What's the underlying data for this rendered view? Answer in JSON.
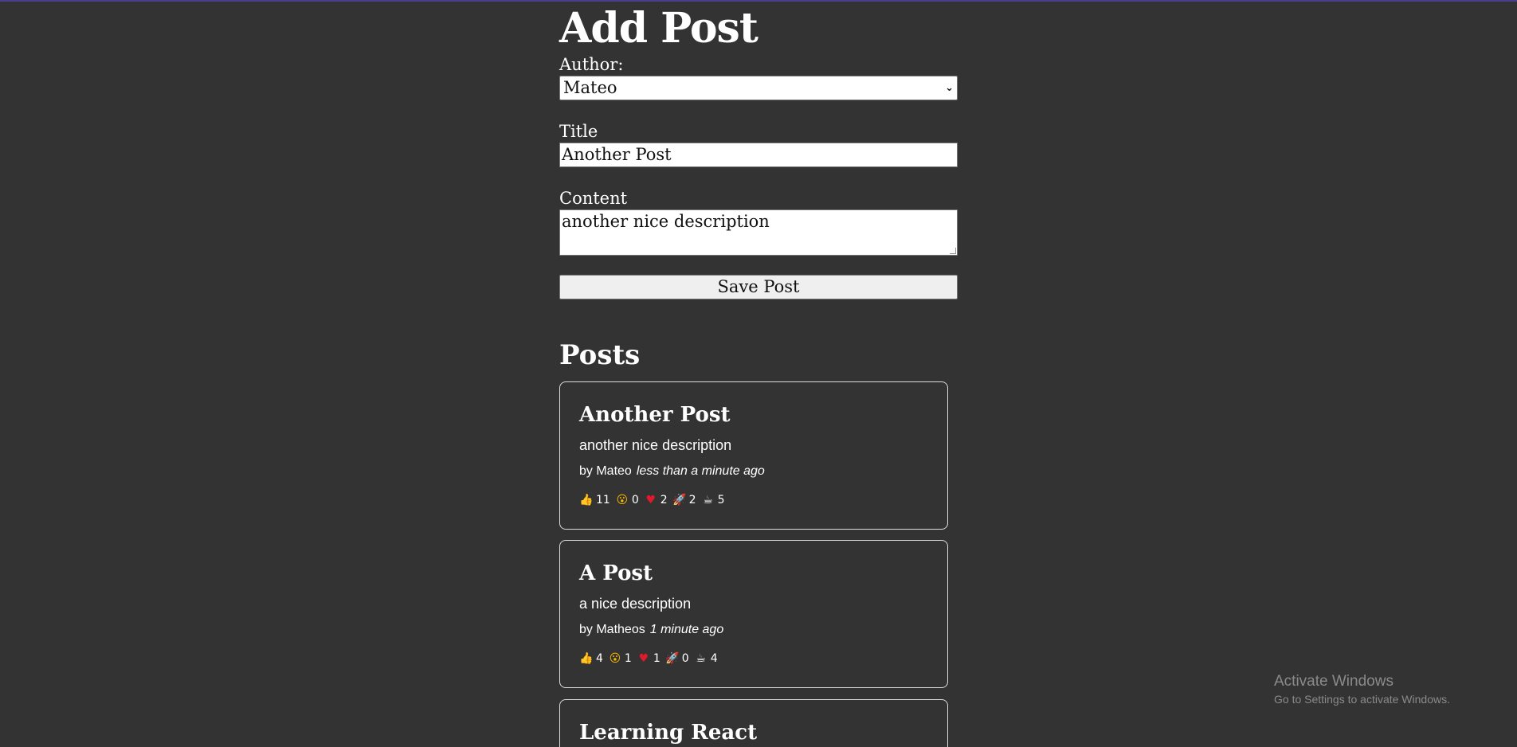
{
  "form": {
    "heading": "Add Post",
    "author_label": "Author:",
    "author_selected": "Mateo",
    "title_label": "Title",
    "title_value": "Another Post",
    "content_label": "Content",
    "content_value": "another nice description",
    "save_label": "Save Post"
  },
  "posts_section": {
    "heading": "Posts",
    "posts": [
      {
        "title": "Another Post",
        "content": "another nice description",
        "author": "by Mateo",
        "time": "less than a minute ago",
        "reactions": [
          {
            "icon": "thumbs-up",
            "emoji": "👍",
            "count": "11"
          },
          {
            "icon": "wow",
            "emoji": "😮",
            "count": "0"
          },
          {
            "icon": "heart",
            "emoji": "♥",
            "count": "2"
          },
          {
            "icon": "rocket",
            "emoji": "🚀",
            "count": "2"
          },
          {
            "icon": "coffee",
            "emoji": "☕",
            "count": "5"
          }
        ]
      },
      {
        "title": "A Post",
        "content": "a nice description",
        "author": "by Matheos",
        "time": "1 minute ago",
        "reactions": [
          {
            "icon": "thumbs-up",
            "emoji": "👍",
            "count": "4"
          },
          {
            "icon": "wow",
            "emoji": "😮",
            "count": "1"
          },
          {
            "icon": "heart",
            "emoji": "♥",
            "count": "1"
          },
          {
            "icon": "rocket",
            "emoji": "🚀",
            "count": "0"
          },
          {
            "icon": "coffee",
            "emoji": "☕",
            "count": "4"
          }
        ]
      },
      {
        "title": "Learning React"
      }
    ]
  },
  "watermark": {
    "line1": "Activate Windows",
    "line2": "Go to Settings to activate Windows."
  },
  "colors": {
    "background": "#333333",
    "accent": "#4b3c8f",
    "card_border": "#dddddd"
  }
}
